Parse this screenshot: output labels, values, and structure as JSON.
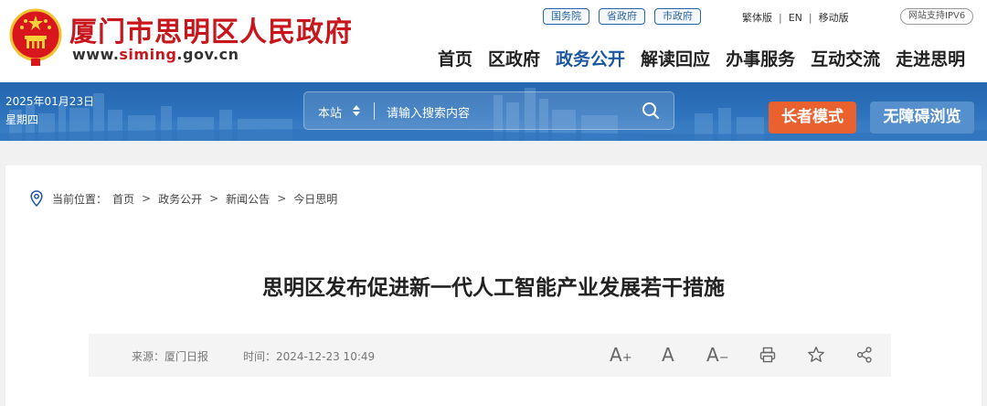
{
  "header": {
    "site_name": "厦门市思明区人民政府",
    "url_prefix": "www.",
    "url_highlight": "siming",
    "url_suffix": ".gov.cn",
    "gov_links": [
      "国务院",
      "省政府",
      "市政府"
    ],
    "top_links": [
      "繁体版",
      "EN",
      "移动版"
    ],
    "ipv6": "网站支持IPV6",
    "nav": [
      "首页",
      "区政府",
      "政务公开",
      "解读回应",
      "办事服务",
      "互动交流",
      "走进思明"
    ],
    "active_nav": "政务公开"
  },
  "banner": {
    "date": "2025年01月23日",
    "weekday": "星期四",
    "search_scope": "本站",
    "search_placeholder": "请输入搜索内容",
    "elder_mode": "长者模式",
    "accessibility": "无障碍浏览"
  },
  "breadcrumb": {
    "label": "当前位置：",
    "items": [
      "首页",
      "政务公开",
      "新闻公告",
      "今日思明"
    ]
  },
  "article": {
    "title": "思明区发布促进新一代人工智能产业发展若干措施",
    "source": "来源：厦门日报",
    "time": "时间：2024-12-23 10:49"
  },
  "tools": {
    "enlarge": "A",
    "normal": "A",
    "shrink": "A"
  },
  "colors": {
    "brand_red": "#c8161d",
    "nav_blue": "#1c57a2",
    "elder_button": "#e8612f",
    "access_button": "#5690cc"
  }
}
